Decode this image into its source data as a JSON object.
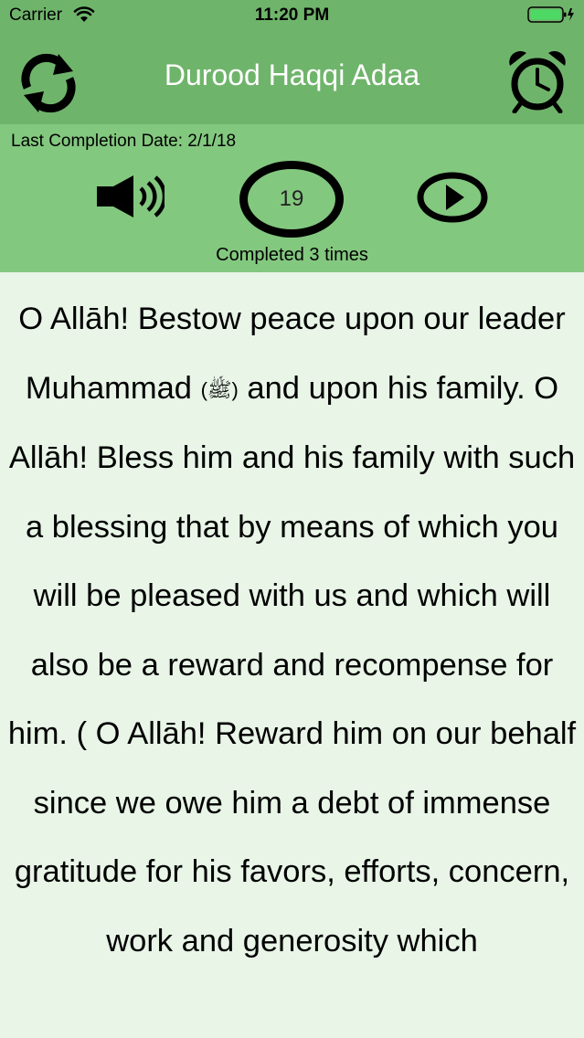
{
  "status": {
    "carrier": "Carrier",
    "time": "11:20 PM"
  },
  "nav": {
    "title": "Durood Haqqi Adaa"
  },
  "panel": {
    "last_completion": "Last Completion Date: 2/1/18",
    "count": "19",
    "completed": "Completed 3 times"
  },
  "prayer": {
    "part1": "O Allāh! Bestow peace upon our leader Muhammad",
    "honorific": "(ﷺ)",
    "part2": "and upon his family. O Allāh! Bless him and his family with such a blessing that by means of which you will be pleased with us and which will also be a reward and recompense for him. ( O Allāh! Reward him on our behalf since we owe him a debt of immense gratitude for his favors, efforts, concern, work and generosity which"
  },
  "colors": {
    "header": "#6fb46b",
    "panel": "#83c87f",
    "content_bg": "#e8f5e7",
    "title": "#ffffff",
    "battery": "#4cd964"
  },
  "icons": {
    "refresh": "refresh-icon",
    "alarm": "alarm-clock-icon",
    "speaker": "speaker-icon",
    "play": "play-icon",
    "wifi": "wifi-icon",
    "battery": "battery-icon"
  }
}
